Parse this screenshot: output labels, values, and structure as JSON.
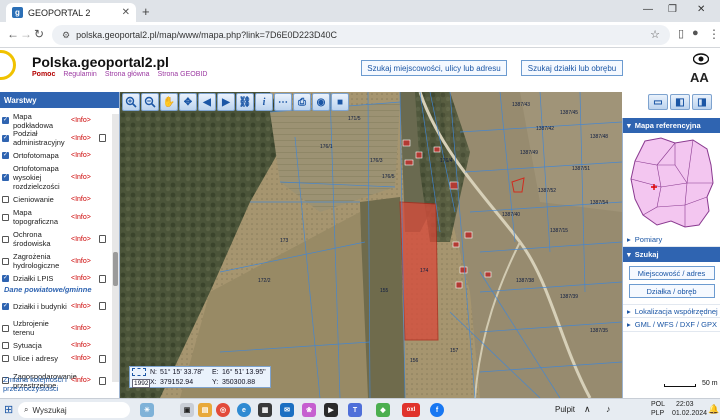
{
  "browser": {
    "tab_title": "GEOPORTAL 2",
    "tab_favicon": "g",
    "url": "polska.geoportal2.pl/map/www/mapa.php?link=7D6E0D223D40C"
  },
  "header": {
    "site_title": "Polska.geoportal2.pl",
    "links": {
      "help": "Pomoc",
      "terms": "Regulamin",
      "home": "Strona główna",
      "geobid": "Strona GEOBID"
    },
    "search_place_button": "Szukaj miejscowości, ulicy lub adresu",
    "search_parcel_button": "Szukaj działki lub obrębu",
    "font_size_label": "AA"
  },
  "layers_panel": {
    "title": "Warstwy",
    "info_label": "<Info>",
    "items": [
      {
        "label": "Mapa podkładowa",
        "checked": true,
        "doc": false
      },
      {
        "label": "Podział administracyjny",
        "checked": true,
        "doc": true
      },
      {
        "label": "Ortofotomapa",
        "checked": true,
        "doc": false
      },
      {
        "label": "Ortofotomapa wysokiej rozdzielczości",
        "checked": true,
        "doc": false
      },
      {
        "label": "Cieniowanie",
        "checked": false,
        "doc": false
      },
      {
        "label": "Mapa topograficzna",
        "checked": false,
        "doc": false
      },
      {
        "label": "Ochrona środowiska",
        "checked": false,
        "doc": true
      },
      {
        "label": "Zagrożenia hydrologiczne",
        "checked": false,
        "doc": false
      },
      {
        "label": "Działki LPIS",
        "checked": true,
        "doc": true
      }
    ],
    "section_label": "Dane powiatowe/gminne",
    "county_items": [
      {
        "label": "Działki i budynki",
        "checked": true,
        "doc": true
      },
      {
        "label": "Uzbrojenie terenu",
        "checked": false,
        "doc": false
      },
      {
        "label": "Sytuacja",
        "checked": false,
        "doc": false
      },
      {
        "label": "Ulice i adresy",
        "checked": false,
        "doc": true
      },
      {
        "label": "Zagospodarowanie przestrzenne",
        "checked": false,
        "doc": true
      }
    ],
    "order_link": "Zmiana kolejności i przezroczystości"
  },
  "map": {
    "coords": {
      "system": "1992",
      "n_label": "N:",
      "n_value": "51° 15' 33.78\"",
      "e_label": "E:",
      "e_value": "16° 51' 13.95\"",
      "x_label": "X:",
      "x_value": "379152.94",
      "y_label": "Y:",
      "y_value": "350300.88"
    },
    "scale_label": "50 m",
    "parcel_labels": [
      "1387/43",
      "1387/42",
      "1387/45",
      "1387/48",
      "1387/49",
      "1387/51",
      "1387/52",
      "1387/54",
      "1387/40",
      "1387/15",
      "171/5",
      "176/1",
      "176/3",
      "176/5",
      "174",
      "176/4",
      "173",
      "172/2",
      "155",
      "156",
      "157",
      "1387/38",
      "1387/39",
      "1387/35"
    ]
  },
  "right_panel": {
    "ref_map_title": "Mapa referencyjna",
    "measure_label": "Pomiary",
    "search_title": "Szukaj",
    "place_button": "Miejscowość / adres",
    "parcel_button": "Działka / obręb",
    "coord_loc_label": "Lokalizacja współrzędnej",
    "export_label": "GML / WFS / DXF / GPX"
  },
  "taskbar": {
    "search_placeholder": "Wyszukaj",
    "ticker": "Pulpit",
    "lang1": "POL",
    "lang2": "PLP",
    "time": "22:03",
    "date": "01.02.2024"
  },
  "colors": {
    "accent": "#2f64b1",
    "parcel_highlight": "#d94a3a"
  }
}
